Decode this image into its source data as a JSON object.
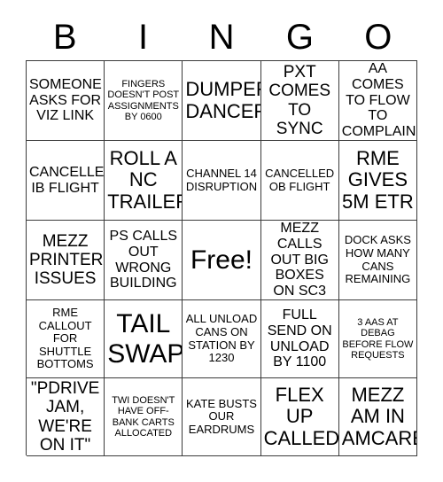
{
  "header": {
    "letters": [
      "B",
      "I",
      "N",
      "G",
      "O"
    ]
  },
  "grid": {
    "rows": 5,
    "columns": 5,
    "border_color": "#3a3a3a",
    "background_color": "#ffffff",
    "text_color": "#000000",
    "cells": [
      [
        {
          "text": "SOMEONE ASKS FOR VIZ LINK",
          "size": "md"
        },
        {
          "text": "FINGERS DOESN'T POST ASSIGNMENTS BY 0600",
          "size": "xs"
        },
        {
          "text": "DUMPER DANCER",
          "size": "xl"
        },
        {
          "text": "PXT COMES TO SYNC",
          "size": "lg"
        },
        {
          "text": "AA COMES TO FLOW TO COMPLAIN",
          "size": "md"
        }
      ],
      [
        {
          "text": "CANCELLED IB FLIGHT",
          "size": "md"
        },
        {
          "text": "ROLL A NC TRAILER",
          "size": "xl"
        },
        {
          "text": "CHANNEL 14 DISRUPTION",
          "size": "sm"
        },
        {
          "text": "CANCELLED OB FLIGHT",
          "size": "sm"
        },
        {
          "text": "RME GIVES 5M ETR",
          "size": "xl"
        }
      ],
      [
        {
          "text": "MEZZ PRINTER ISSUES",
          "size": "lg"
        },
        {
          "text": "PS CALLS OUT WRONG BUILDING",
          "size": "md"
        },
        {
          "text": "Free!",
          "size": "xxl"
        },
        {
          "text": "MEZZ CALLS OUT BIG BOXES ON SC3",
          "size": "md"
        },
        {
          "text": "DOCK ASKS HOW MANY CANS REMAINING",
          "size": "sm"
        }
      ],
      [
        {
          "text": "RME CALLOUT FOR SHUTTLE BOTTOMS",
          "size": "sm"
        },
        {
          "text": "TAIL SWAP",
          "size": "xxl"
        },
        {
          "text": "ALL UNLOAD CANS ON STATION BY 1230",
          "size": "sm"
        },
        {
          "text": "FULL SEND ON UNLOAD BY 1100",
          "size": "md"
        },
        {
          "text": "3 AAS AT DEBAG BEFORE FLOW REQUESTS",
          "size": "xs"
        }
      ],
      [
        {
          "text": "\"PDRIVE JAM, WE'RE ON IT\"",
          "size": "lg"
        },
        {
          "text": "TWI DOESN'T HAVE OFF-BANK CARTS ALLOCATED",
          "size": "xs"
        },
        {
          "text": "KATE BUSTS OUR EARDRUMS",
          "size": "sm"
        },
        {
          "text": "FLEX UP CALLED",
          "size": "xl"
        },
        {
          "text": "MEZZ AM IN AMCARE",
          "size": "xl"
        }
      ]
    ]
  }
}
